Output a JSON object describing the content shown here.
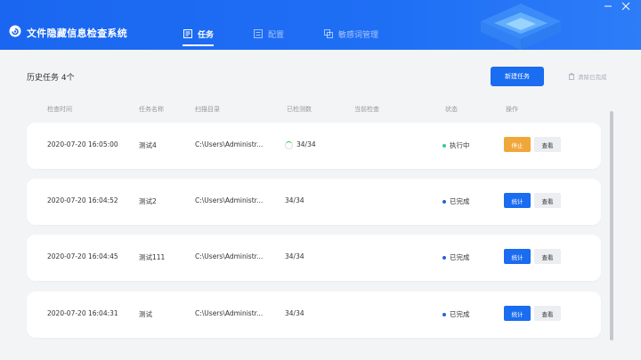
{
  "header": {
    "app_title": "文件隐藏信息检查系统",
    "tabs": [
      {
        "label": "任务",
        "icon": "task-icon",
        "active": true
      },
      {
        "label": "配置",
        "icon": "config-icon",
        "active": false
      },
      {
        "label": "敏感词管理",
        "icon": "keyword-icon",
        "active": false
      }
    ]
  },
  "toolbar": {
    "history_title": "历史任务 4个",
    "new_task_label": "新建任务",
    "clear_done_label": "清除已完成"
  },
  "table": {
    "columns": [
      "检查时间",
      "任务名称",
      "扫描目录",
      "已检测数",
      "当前检查",
      "状态",
      "操作"
    ],
    "rows": [
      {
        "time": "2020-07-20 16:05:00",
        "name": "测试4",
        "dir": "C:\\Users\\Administr...",
        "count": "34/34",
        "current": "",
        "status": "执行中",
        "action": "停止",
        "view": "查看",
        "running": true
      },
      {
        "time": "2020-07-20 16:04:52",
        "name": "测试2",
        "dir": "C:\\Users\\Administr...",
        "count": "34/34",
        "current": "",
        "status": "已完成",
        "action": "统计",
        "view": "查看",
        "running": false
      },
      {
        "time": "2020-07-20 16:04:45",
        "name": "测试111",
        "dir": "C:\\Users\\Administr...",
        "count": "34/34",
        "current": "",
        "status": "已完成",
        "action": "统计",
        "view": "查看",
        "running": false
      },
      {
        "time": "2020-07-20 16:04:31",
        "name": "测试",
        "dir": "C:\\Users\\Administr...",
        "count": "34/34",
        "current": "",
        "status": "已完成",
        "action": "统计",
        "view": "查看",
        "running": false
      }
    ]
  },
  "colors": {
    "primary": "#1a6cf0",
    "stop": "#f0a73a",
    "running_dot": "#3cc6a0",
    "done_dot": "#2b62d6"
  }
}
